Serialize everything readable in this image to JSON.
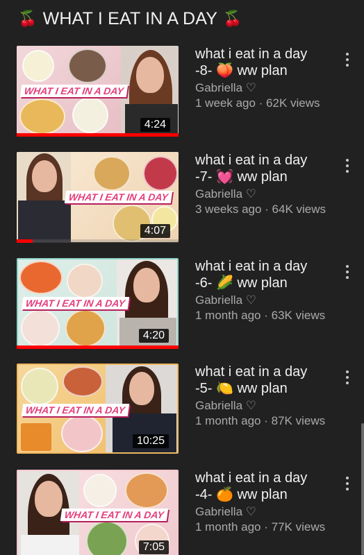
{
  "playlist": {
    "title_prefix_emoji": "🍒",
    "title": "WHAT I EAT IN A DAY",
    "title_suffix_emoji": "🍒"
  },
  "videos": [
    {
      "title_line1": "what i eat in a day",
      "title_line2": "-8- 🍑 ww plan",
      "channel": "Gabriella ♡",
      "stats": "1 week ago · 62K views",
      "duration": "4:24",
      "banner": "WHAT I EAT IN A DAY",
      "watched_fraction": 1.0,
      "accent": "#e8c3c8"
    },
    {
      "title_line1": "what i eat in a day",
      "title_line2": "-7- 💓 ww plan",
      "channel": "Gabriella ♡",
      "stats": "3 weeks ago · 64K views",
      "duration": "4:07",
      "banner": "WHAT I EAT IN A DAY",
      "watched_fraction": 0.1,
      "accent": "#f2d9b5"
    },
    {
      "title_line1": "what i eat in a day",
      "title_line2": "-6- 🌽 ww plan",
      "channel": "Gabriella ♡",
      "stats": "1 month ago · 63K views",
      "duration": "4:20",
      "banner": "WHAT I EAT IN A DAY",
      "watched_fraction": 1.0,
      "accent": "#9fd8d0"
    },
    {
      "title_line1": "what i eat in a day",
      "title_line2": "-5- 🍋 ww plan",
      "channel": "Gabriella ♡",
      "stats": "1 month ago · 87K views",
      "duration": "10:25",
      "banner": "WHAT I EAT IN A DAY",
      "watched_fraction": 0,
      "accent": "#f0b760"
    },
    {
      "title_line1": "what i eat in a day",
      "title_line2": "-4- 🍊 ww plan",
      "channel": "Gabriella ♡",
      "stats": "1 month ago · 77K views",
      "duration": "7:05",
      "banner": "WHAT I EAT IN A DAY",
      "watched_fraction": 0,
      "accent": "#f4c8cf"
    }
  ],
  "icons": {
    "more": "more-vert-icon"
  },
  "colors": {
    "background": "#212121",
    "progress": "#ff0000",
    "banner_text": "#e53d7a"
  }
}
